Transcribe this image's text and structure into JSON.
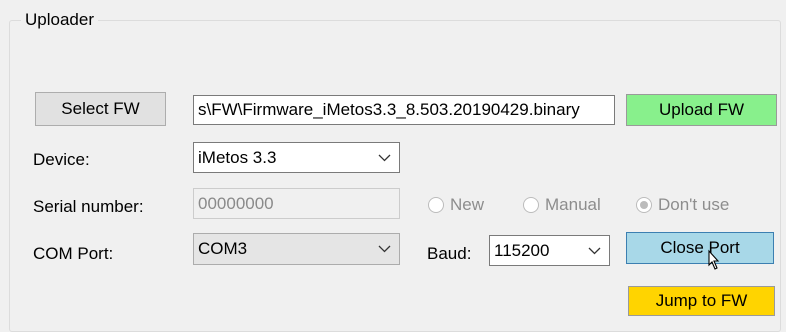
{
  "group": {
    "title": "Uploader"
  },
  "firmware": {
    "select_label": "Select FW",
    "path_value": "s\\FW\\Firmware_iMetos3.3_8.503.20190429.binary",
    "upload_label": "Upload FW"
  },
  "device": {
    "label": "Device:",
    "selected": "iMetos 3.3"
  },
  "serial": {
    "label": "Serial number:",
    "value": "00000000",
    "options": [
      {
        "label": "New",
        "checked": false
      },
      {
        "label": "Manual",
        "checked": false
      },
      {
        "label": "Don't use",
        "checked": true
      }
    ]
  },
  "com": {
    "label": "COM Port:",
    "selected": "COM3"
  },
  "baud": {
    "label": "Baud:",
    "selected": "115200"
  },
  "buttons": {
    "close_port": "Close Port",
    "jump": "Jump to FW"
  },
  "colors": {
    "upload_bg": "#88f08c",
    "close_port_bg": "#a8d8e8",
    "jump_bg": "#ffd400"
  },
  "icons": {
    "dropdown": "chevron-down-icon",
    "cursor": "mouse-pointer-icon"
  }
}
